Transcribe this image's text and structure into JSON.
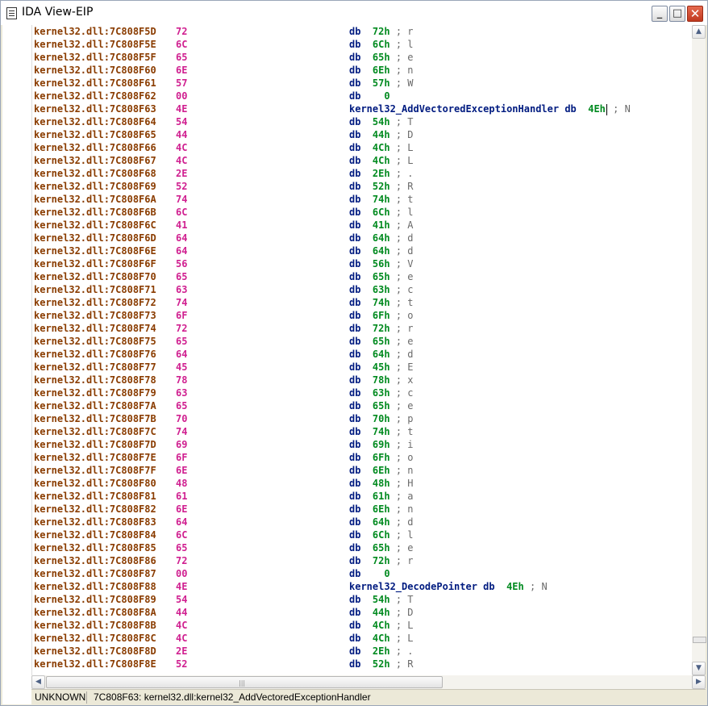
{
  "window": {
    "title": "IDA View-EIP"
  },
  "buttons": {
    "minimize": "_",
    "maximize": "□",
    "close": "✕"
  },
  "listing": [
    {
      "addr": "kernel32.dll:7C808F5D",
      "byte": "72",
      "pre": "",
      "op": "db",
      "arg": "72h",
      "comment": "; r",
      "marker": true
    },
    {
      "addr": "kernel32.dll:7C808F5E",
      "byte": "6C",
      "pre": "",
      "op": "db",
      "arg": "6Ch",
      "comment": "; l",
      "marker": true
    },
    {
      "addr": "kernel32.dll:7C808F5F",
      "byte": "65",
      "pre": "",
      "op": "db",
      "arg": "65h",
      "comment": "; e",
      "marker": true
    },
    {
      "addr": "kernel32.dll:7C808F60",
      "byte": "6E",
      "pre": "",
      "op": "db",
      "arg": "6Eh",
      "comment": "; n",
      "marker": true
    },
    {
      "addr": "kernel32.dll:7C808F61",
      "byte": "57",
      "pre": "",
      "op": "db",
      "arg": "57h",
      "comment": "; W",
      "marker": true
    },
    {
      "addr": "kernel32.dll:7C808F62",
      "byte": "00",
      "pre": "",
      "op": "db",
      "arg": "  0",
      "comment": "",
      "marker": true
    },
    {
      "addr": "kernel32.dll:7C808F63",
      "byte": "4E",
      "pre": "kernel32_AddVectoredExceptionHandler ",
      "op": "db",
      "arg": "4Eh",
      "comment": " ; N",
      "marker": true,
      "cursor": true
    },
    {
      "addr": "kernel32.dll:7C808F64",
      "byte": "54",
      "pre": "",
      "op": "db",
      "arg": "54h",
      "comment": "; T",
      "marker": true
    },
    {
      "addr": "kernel32.dll:7C808F65",
      "byte": "44",
      "pre": "",
      "op": "db",
      "arg": "44h",
      "comment": "; D",
      "marker": true
    },
    {
      "addr": "kernel32.dll:7C808F66",
      "byte": "4C",
      "pre": "",
      "op": "db",
      "arg": "4Ch",
      "comment": "; L",
      "marker": true
    },
    {
      "addr": "kernel32.dll:7C808F67",
      "byte": "4C",
      "pre": "",
      "op": "db",
      "arg": "4Ch",
      "comment": "; L",
      "marker": true
    },
    {
      "addr": "kernel32.dll:7C808F68",
      "byte": "2E",
      "pre": "",
      "op": "db",
      "arg": "2Eh",
      "comment": "; .",
      "marker": true
    },
    {
      "addr": "kernel32.dll:7C808F69",
      "byte": "52",
      "pre": "",
      "op": "db",
      "arg": "52h",
      "comment": "; R",
      "marker": true
    },
    {
      "addr": "kernel32.dll:7C808F6A",
      "byte": "74",
      "pre": "",
      "op": "db",
      "arg": "74h",
      "comment": "; t",
      "marker": true
    },
    {
      "addr": "kernel32.dll:7C808F6B",
      "byte": "6C",
      "pre": "",
      "op": "db",
      "arg": "6Ch",
      "comment": "; l",
      "marker": true
    },
    {
      "addr": "kernel32.dll:7C808F6C",
      "byte": "41",
      "pre": "",
      "op": "db",
      "arg": "41h",
      "comment": "; A",
      "marker": true
    },
    {
      "addr": "kernel32.dll:7C808F6D",
      "byte": "64",
      "pre": "",
      "op": "db",
      "arg": "64h",
      "comment": "; d",
      "marker": true
    },
    {
      "addr": "kernel32.dll:7C808F6E",
      "byte": "64",
      "pre": "",
      "op": "db",
      "arg": "64h",
      "comment": "; d",
      "marker": true
    },
    {
      "addr": "kernel32.dll:7C808F6F",
      "byte": "56",
      "pre": "",
      "op": "db",
      "arg": "56h",
      "comment": "; V",
      "marker": true
    },
    {
      "addr": "kernel32.dll:7C808F70",
      "byte": "65",
      "pre": "",
      "op": "db",
      "arg": "65h",
      "comment": "; e",
      "marker": true
    },
    {
      "addr": "kernel32.dll:7C808F71",
      "byte": "63",
      "pre": "",
      "op": "db",
      "arg": "63h",
      "comment": "; c",
      "marker": true
    },
    {
      "addr": "kernel32.dll:7C808F72",
      "byte": "74",
      "pre": "",
      "op": "db",
      "arg": "74h",
      "comment": "; t",
      "marker": true
    },
    {
      "addr": "kernel32.dll:7C808F73",
      "byte": "6F",
      "pre": "",
      "op": "db",
      "arg": "6Fh",
      "comment": "; o",
      "marker": true
    },
    {
      "addr": "kernel32.dll:7C808F74",
      "byte": "72",
      "pre": "",
      "op": "db",
      "arg": "72h",
      "comment": "; r",
      "marker": true
    },
    {
      "addr": "kernel32.dll:7C808F75",
      "byte": "65",
      "pre": "",
      "op": "db",
      "arg": "65h",
      "comment": "; e",
      "marker": true
    },
    {
      "addr": "kernel32.dll:7C808F76",
      "byte": "64",
      "pre": "",
      "op": "db",
      "arg": "64h",
      "comment": "; d",
      "marker": true
    },
    {
      "addr": "kernel32.dll:7C808F77",
      "byte": "45",
      "pre": "",
      "op": "db",
      "arg": "45h",
      "comment": "; E",
      "marker": true
    },
    {
      "addr": "kernel32.dll:7C808F78",
      "byte": "78",
      "pre": "",
      "op": "db",
      "arg": "78h",
      "comment": "; x",
      "marker": true
    },
    {
      "addr": "kernel32.dll:7C808F79",
      "byte": "63",
      "pre": "",
      "op": "db",
      "arg": "63h",
      "comment": "; c",
      "marker": true
    },
    {
      "addr": "kernel32.dll:7C808F7A",
      "byte": "65",
      "pre": "",
      "op": "db",
      "arg": "65h",
      "comment": "; e",
      "marker": true
    },
    {
      "addr": "kernel32.dll:7C808F7B",
      "byte": "70",
      "pre": "",
      "op": "db",
      "arg": "70h",
      "comment": "; p",
      "marker": true
    },
    {
      "addr": "kernel32.dll:7C808F7C",
      "byte": "74",
      "pre": "",
      "op": "db",
      "arg": "74h",
      "comment": "; t",
      "marker": true
    },
    {
      "addr": "kernel32.dll:7C808F7D",
      "byte": "69",
      "pre": "",
      "op": "db",
      "arg": "69h",
      "comment": "; i",
      "marker": true
    },
    {
      "addr": "kernel32.dll:7C808F7E",
      "byte": "6F",
      "pre": "",
      "op": "db",
      "arg": "6Fh",
      "comment": "; o",
      "marker": true
    },
    {
      "addr": "kernel32.dll:7C808F7F",
      "byte": "6E",
      "pre": "",
      "op": "db",
      "arg": "6Eh",
      "comment": "; n",
      "marker": true
    },
    {
      "addr": "kernel32.dll:7C808F80",
      "byte": "48",
      "pre": "",
      "op": "db",
      "arg": "48h",
      "comment": "; H",
      "marker": true
    },
    {
      "addr": "kernel32.dll:7C808F81",
      "byte": "61",
      "pre": "",
      "op": "db",
      "arg": "61h",
      "comment": "; a",
      "marker": true
    },
    {
      "addr": "kernel32.dll:7C808F82",
      "byte": "6E",
      "pre": "",
      "op": "db",
      "arg": "6Eh",
      "comment": "; n",
      "marker": true
    },
    {
      "addr": "kernel32.dll:7C808F83",
      "byte": "64",
      "pre": "",
      "op": "db",
      "arg": "64h",
      "comment": "; d",
      "marker": true
    },
    {
      "addr": "kernel32.dll:7C808F84",
      "byte": "6C",
      "pre": "",
      "op": "db",
      "arg": "6Ch",
      "comment": "; l",
      "marker": true
    },
    {
      "addr": "kernel32.dll:7C808F85",
      "byte": "65",
      "pre": "",
      "op": "db",
      "arg": "65h",
      "comment": "; e",
      "marker": true
    },
    {
      "addr": "kernel32.dll:7C808F86",
      "byte": "72",
      "pre": "",
      "op": "db",
      "arg": "72h",
      "comment": "; r",
      "marker": true
    },
    {
      "addr": "kernel32.dll:7C808F87",
      "byte": "00",
      "pre": "",
      "op": "db",
      "arg": "  0",
      "comment": "",
      "marker": true
    },
    {
      "addr": "kernel32.dll:7C808F88",
      "byte": "4E",
      "pre": "kernel32_DecodePointer ",
      "op": "db",
      "arg": "4Eh",
      "comment": " ; N",
      "marker": true
    },
    {
      "addr": "kernel32.dll:7C808F89",
      "byte": "54",
      "pre": "",
      "op": "db",
      "arg": "54h",
      "comment": "; T",
      "marker": true
    },
    {
      "addr": "kernel32.dll:7C808F8A",
      "byte": "44",
      "pre": "",
      "op": "db",
      "arg": "44h",
      "comment": "; D",
      "marker": true
    },
    {
      "addr": "kernel32.dll:7C808F8B",
      "byte": "4C",
      "pre": "",
      "op": "db",
      "arg": "4Ch",
      "comment": "; L",
      "marker": true
    },
    {
      "addr": "kernel32.dll:7C808F8C",
      "byte": "4C",
      "pre": "",
      "op": "db",
      "arg": "4Ch",
      "comment": "; L",
      "marker": true
    },
    {
      "addr": "kernel32.dll:7C808F8D",
      "byte": "2E",
      "pre": "",
      "op": "db",
      "arg": "2Eh",
      "comment": "; .",
      "marker": true
    },
    {
      "addr": "kernel32.dll:7C808F8E",
      "byte": "52",
      "pre": "",
      "op": "db",
      "arg": "52h",
      "comment": "; R",
      "marker": true
    }
  ],
  "status": {
    "mode": "UNKNOWN",
    "location": "7C808F63: kernel32.dll:kernel32_AddVectoredExceptionHandler"
  },
  "scrollbar": {
    "grip": "|||"
  },
  "icons": {
    "window": "document-icon",
    "up": "▲",
    "down": "▼",
    "left": "◀",
    "right": "▶"
  },
  "colors": {
    "address": "#8a3c00",
    "byte": "#d02090",
    "keyword": "#001b80",
    "number": "#008a1f",
    "comment": "#6a6a6a",
    "marker": "#19c4d4"
  }
}
